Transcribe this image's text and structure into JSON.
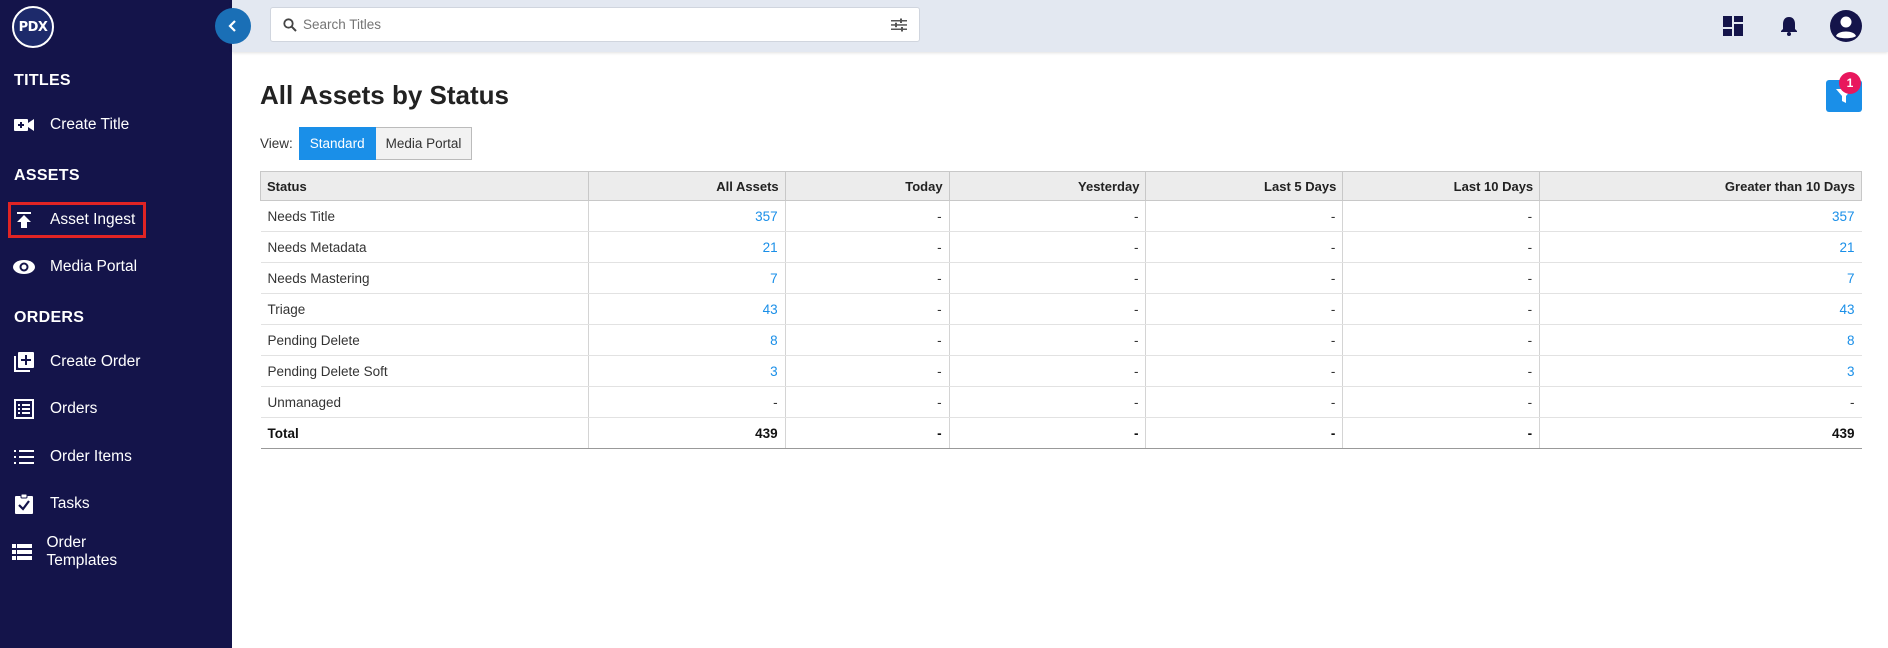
{
  "logo": "PDX",
  "sidebar": {
    "sections": [
      {
        "title": "TITLES"
      },
      {
        "title": "ASSETS"
      },
      {
        "title": "ORDERS"
      }
    ],
    "items": [
      {
        "label": "Create Title",
        "icon": "video-plus-icon"
      },
      {
        "label": "Asset Ingest",
        "icon": "upload-icon"
      },
      {
        "label": "Media Portal",
        "icon": "eye-icon"
      },
      {
        "label": "Create Order",
        "icon": "add-box-icon"
      },
      {
        "label": "Orders",
        "icon": "list-box-icon"
      },
      {
        "label": "Order Items",
        "icon": "list-icon"
      },
      {
        "label": "Tasks",
        "icon": "clipboard-check-icon"
      },
      {
        "label": "Order Templates",
        "icon": "table-rows-icon"
      }
    ]
  },
  "search": {
    "placeholder": "Search Titles"
  },
  "main": {
    "title": "All Assets by Status",
    "filter_count": "1",
    "view_label": "View:",
    "view_options": [
      "Standard",
      "Media Portal"
    ]
  },
  "table": {
    "headers": [
      "Status",
      "All Assets",
      "Today",
      "Yesterday",
      "Last 5 Days",
      "Last 10 Days",
      "Greater than 10 Days"
    ],
    "rows": [
      [
        "Needs Title",
        "357",
        "-",
        "-",
        "-",
        "-",
        "357"
      ],
      [
        "Needs Metadata",
        "21",
        "-",
        "-",
        "-",
        "-",
        "21"
      ],
      [
        "Needs Mastering",
        "7",
        "-",
        "-",
        "-",
        "-",
        "7"
      ],
      [
        "Triage",
        "43",
        "-",
        "-",
        "-",
        "-",
        "43"
      ],
      [
        "Pending Delete",
        "8",
        "-",
        "-",
        "-",
        "-",
        "8"
      ],
      [
        "Pending Delete Soft",
        "3",
        "-",
        "-",
        "-",
        "-",
        "3"
      ],
      [
        "Unmanaged",
        "-",
        "-",
        "-",
        "-",
        "-",
        "-"
      ]
    ],
    "total": [
      "Total",
      "439",
      "-",
      "-",
      "-",
      "-",
      "439"
    ]
  },
  "colors": {
    "sidebar_bg": "#14144a",
    "accent": "#1a8fe8",
    "badge": "#e8175d",
    "highlight_outline": "#e02424"
  }
}
